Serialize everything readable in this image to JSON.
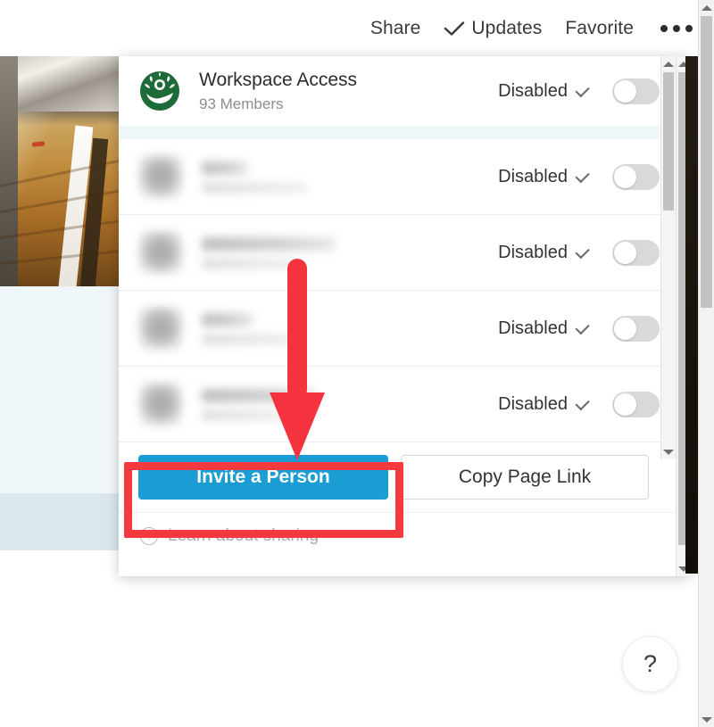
{
  "topbar": {
    "share_label": "Share",
    "updates_label": "Updates",
    "updates_icon": "check-icon",
    "favorite_label": "Favorite",
    "more_icon": "ellipsis-icon"
  },
  "panel": {
    "workspace": {
      "logo_icon": "workspace-emblem-icon",
      "title": "Workspace Access",
      "subtitle": "93 Members",
      "permission": "Disabled",
      "caret_icon": "chevron-down-icon",
      "toggle_on": false
    },
    "members": [
      {
        "name": "",
        "subtitle": "",
        "permission": "Disabled",
        "toggle_on": false
      },
      {
        "name": "",
        "subtitle": "",
        "permission": "Disabled",
        "toggle_on": false
      },
      {
        "name": "",
        "subtitle": "",
        "permission": "Disabled",
        "toggle_on": false
      },
      {
        "name": "",
        "subtitle": "",
        "permission": "Disabled",
        "toggle_on": false
      }
    ],
    "actions": {
      "invite_label": "Invite a Person",
      "copy_link_label": "Copy Page Link"
    },
    "footer": {
      "help_icon": "question-circle-icon",
      "learn_label": "Learn about sharing"
    }
  },
  "help_fab": {
    "label": "?",
    "icon": "question-mark-icon"
  },
  "annotations": {
    "arrow_icon": "down-arrow-annotation",
    "highlight_target": "Invite a Person"
  },
  "colors": {
    "accent_blue": "#1b9dd3",
    "annotation_red": "#f53a3f",
    "workspace_green": "#1c6b38",
    "toggle_track": "#d9d9d9",
    "highlight_row": "#eff7fa"
  }
}
